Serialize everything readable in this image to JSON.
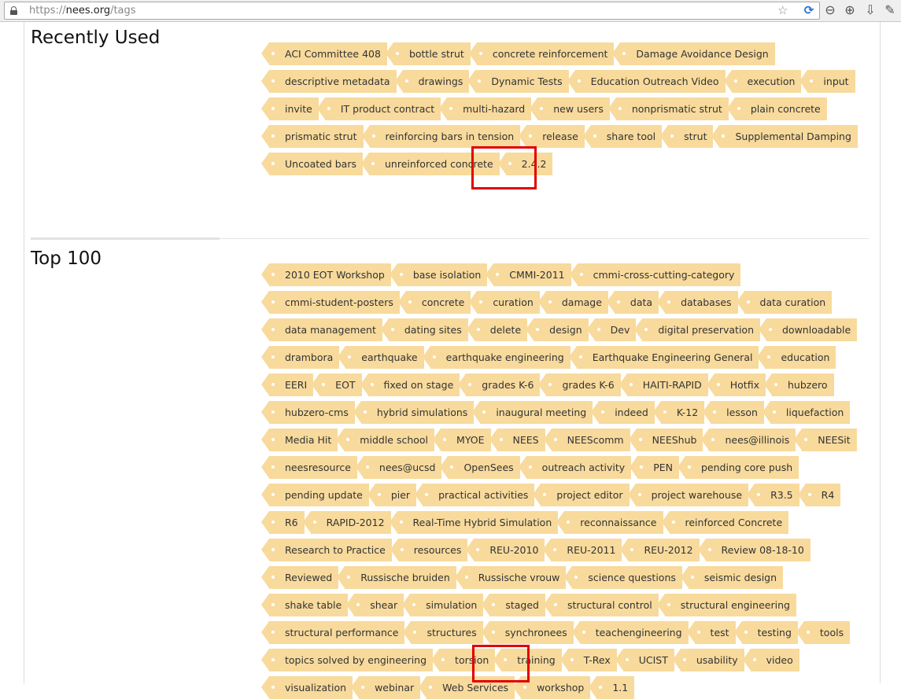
{
  "browser": {
    "url_protocol": "https://",
    "url_host": "nees.org",
    "url_path": "/tags"
  },
  "sections": {
    "recent": {
      "title": "Recently Used",
      "tags": [
        "ACI Committee 408",
        "bottle strut",
        "concrete reinforcement",
        "Damage Avoidance Design",
        "descriptive metadata",
        "drawings",
        "Dynamic Tests",
        "Education Outreach Video",
        "execution",
        "input",
        "invite",
        "IT product contract",
        "multi-hazard",
        "new users",
        "nonprismatic strut",
        "plain concrete",
        "prismatic strut",
        "reinforcing bars in tension",
        "release",
        "share tool",
        "strut",
        "Supplemental Damping",
        "Uncoated bars",
        "unreinforced concrete",
        "2.4.2"
      ]
    },
    "top": {
      "title": "Top 100",
      "tags": [
        "2010 EOT Workshop",
        "base isolation",
        "CMMI-2011",
        "cmmi-cross-cutting-category",
        "cmmi-student-posters",
        "concrete",
        "curation",
        "damage",
        "data",
        "databases",
        "data curation",
        "data management",
        "dating sites",
        "delete",
        "design",
        "Dev",
        "digital preservation",
        "downloadable",
        "drambora",
        "earthquake",
        "earthquake engineering",
        "Earthquake Engineering General",
        "education",
        "EERI",
        "EOT",
        "fixed on stage",
        "grades K-6",
        "grades K-6",
        "HAITI-RAPID",
        "Hotfix",
        "hubzero",
        "hubzero-cms",
        "hybrid simulations",
        "inaugural meeting",
        "indeed",
        "K-12",
        "lesson",
        "liquefaction",
        "Media Hit",
        "middle school",
        "MYOE",
        "NEES",
        "NEEScomm",
        "NEEShub",
        "nees@illinois",
        "NEESit",
        "neesresource",
        "nees@ucsd",
        "OpenSees",
        "outreach activity",
        "PEN",
        "pending core push",
        "pending update",
        "pier",
        "practical activities",
        "project editor",
        "project warehouse",
        "R3.5",
        "R4",
        "R6",
        "RAPID-2012",
        "Real-Time Hybrid Simulation",
        "reconnaissance",
        "reinforced Concrete",
        "Research to Practice",
        "resources",
        "REU-2010",
        "REU-2011",
        "REU-2012",
        "Review 08-18-10",
        "Reviewed",
        "Russische bruiden",
        "Russische vrouw",
        "science questions",
        "seismic design",
        "shake table",
        "shear",
        "simulation",
        "staged",
        "structural control",
        "structural engineering",
        "structural performance",
        "structures",
        "synchronees",
        "teachengineering",
        "test",
        "testing",
        "tools",
        "topics solved by engineering",
        "torsion",
        "training",
        "T-Rex",
        "UCIST",
        "usability",
        "video",
        "visualization",
        "webinar",
        "Web Services",
        "workshop",
        "1.1"
      ]
    }
  }
}
